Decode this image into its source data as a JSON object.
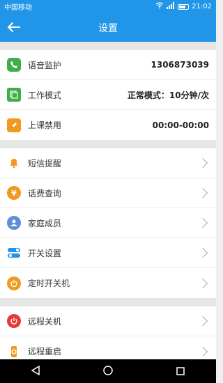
{
  "status": {
    "carrier": "中国移动",
    "time": "21:02"
  },
  "header": {
    "title": "设置"
  },
  "group1": [
    {
      "label": "语音监护",
      "value": "1306873039"
    },
    {
      "label": "工作模式",
      "value": "正常模式：10分钟/次"
    },
    {
      "label": "上课禁用",
      "value": "00:00-00:00"
    }
  ],
  "group2": [
    {
      "label": "短信提醒"
    },
    {
      "label": "话费查询"
    },
    {
      "label": "家庭成员"
    },
    {
      "label": "开关设置"
    },
    {
      "label": "定时开关机"
    }
  ],
  "group3": [
    {
      "label": "远程关机"
    },
    {
      "label": "远程重启"
    }
  ],
  "icons": {
    "voice": "phone-icon",
    "mode": "windows-icon",
    "class": "pencil-icon",
    "sms": "bell-icon",
    "fee": "yen-icon",
    "family": "users-icon",
    "switch": "toggle-icon",
    "timer": "power-timer-icon",
    "shutdown": "power-icon",
    "restart": "watch-icon"
  },
  "colors": {
    "primary": "#2196e8",
    "green": "#3fae4a",
    "orange": "#f09a1f",
    "red": "#e53935"
  }
}
